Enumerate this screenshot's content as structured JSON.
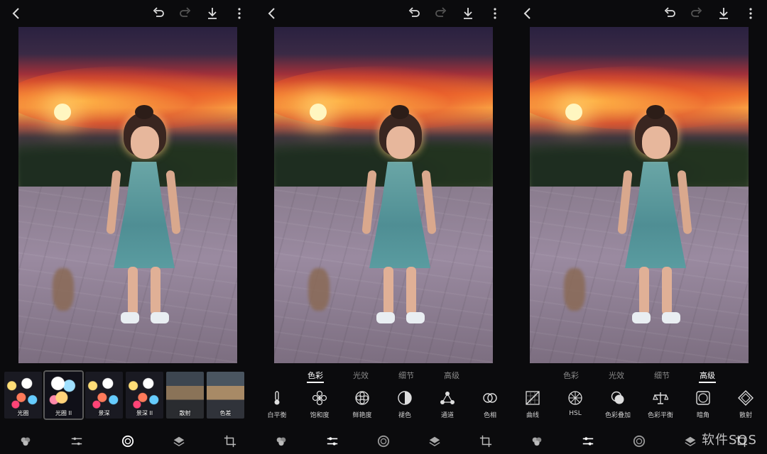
{
  "panels": [
    {
      "bottom_nav": [
        "looks-icon",
        "adjust-icon",
        "lens-blur-icon",
        "layers-icon",
        "crop-icon"
      ],
      "filters": [
        {
          "label": "光圈"
        },
        {
          "label": "光圈 II"
        },
        {
          "label": "景深"
        },
        {
          "label": "景深 II"
        },
        {
          "label": "散射"
        },
        {
          "label": "色差"
        }
      ]
    },
    {
      "tabs": [
        "色彩",
        "光效",
        "细节",
        "高级"
      ],
      "active_tab": "色彩",
      "tools": [
        {
          "label": "白平衡",
          "icon": "thermometer-icon"
        },
        {
          "label": "饱和度",
          "icon": "flower-icon"
        },
        {
          "label": "鲜艳度",
          "icon": "flower2-icon"
        },
        {
          "label": "褪色",
          "icon": "half-circle-icon"
        },
        {
          "label": "通道",
          "icon": "channels-icon"
        },
        {
          "label": "色相",
          "icon": "rings-icon"
        }
      ]
    },
    {
      "tabs": [
        "色彩",
        "光效",
        "细节",
        "高级"
      ],
      "active_tab": "高级",
      "tools": [
        {
          "label": "曲线",
          "icon": "curves-icon"
        },
        {
          "label": "HSL",
          "icon": "hsl-icon"
        },
        {
          "label": "色彩叠加",
          "icon": "overlay-icon"
        },
        {
          "label": "色彩平衡",
          "icon": "balance-icon"
        },
        {
          "label": "暗角",
          "icon": "vignette-icon"
        },
        {
          "label": "散射",
          "icon": "diffuse-icon"
        }
      ]
    }
  ],
  "watermark": "软件SOS",
  "colors": {
    "background": "#0b0b0d",
    "active_tab": "#ffffff",
    "inactive_tab": "#8a8a8a"
  }
}
